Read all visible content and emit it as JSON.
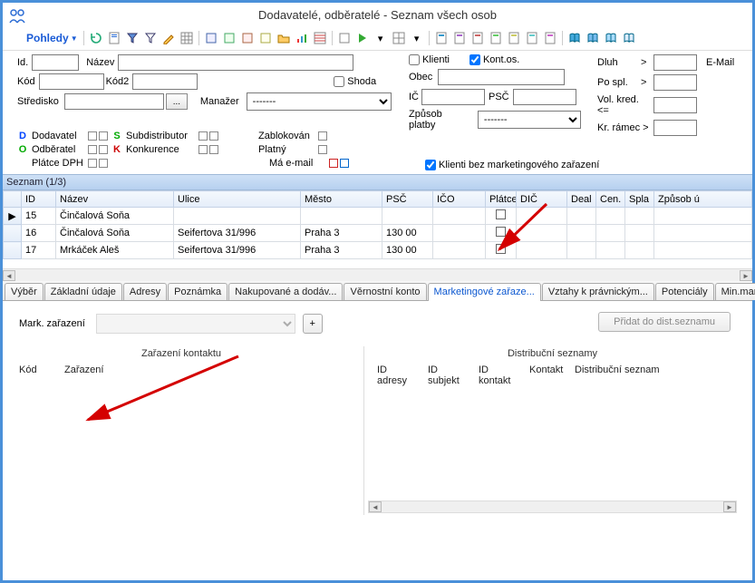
{
  "window": {
    "title": "Dodavatelé, odběratelé - Seznam všech osob"
  },
  "toolbar": {
    "views_label": "Pohledy"
  },
  "filters": {
    "id_label": "Id.",
    "name_label": "Název",
    "kod_label": "Kód",
    "kod2_label": "Kód2",
    "shoda_label": "Shoda",
    "stredisko_label": "Středisko",
    "browse_label": "...",
    "manazer_label": "Manažer",
    "manazer_value": "-------",
    "obec_label": "Obec",
    "ic_label": "IČ",
    "psc_label": "PSČ",
    "zpusob_label": "Způsob platby",
    "zpusob_value": "-------",
    "klienti_label": "Klienti",
    "kontos_label": "Kont.os.",
    "dluh_label": "Dluh",
    "gt": ">",
    "pospl_label": "Po spl.",
    "volkred_label": "Vol. kred. <=",
    "krramec_label": "Kr. rámec >",
    "email_label": "E-Mail",
    "zablokovan_label": "Zablokován",
    "platny_label": "Platný",
    "maemail_label": "Má e-mail",
    "klienti_bez_label": "Klienti bez marketingového zařazení"
  },
  "legend": {
    "d_letter": "D",
    "d_label": "Dodavatel",
    "o_letter": "O",
    "o_label": "Odběratel",
    "platce": "Plátce DPH",
    "s_letter": "S",
    "s_label": "Subdistributor",
    "k_letter": "K",
    "k_label": "Konkurence"
  },
  "grid": {
    "caption": "Seznam (1/3)",
    "columns": [
      "ID",
      "Název",
      "Ulice",
      "Město",
      "PSČ",
      "IČO",
      "Plátce",
      "DIČ",
      "Deal",
      "Cen.",
      "Spla",
      "Způsob ú"
    ],
    "rows": [
      {
        "id": "15",
        "nazev": "Činčalová Soňa",
        "ulice": "",
        "mesto": "",
        "psc": "",
        "ico": ""
      },
      {
        "id": "16",
        "nazev": "Činčalová Soňa",
        "ulice": "Seifertova 31/996",
        "mesto": "Praha 3",
        "psc": "130 00",
        "ico": ""
      },
      {
        "id": "17",
        "nazev": "Mrkáček  Aleš",
        "ulice": "Seifertova 31/996",
        "mesto": "Praha 3",
        "psc": "130 00",
        "ico": ""
      }
    ]
  },
  "tabs": {
    "items": [
      {
        "label": "Výběr"
      },
      {
        "label": "Základní údaje"
      },
      {
        "label": "Adresy"
      },
      {
        "label": "Poznámka"
      },
      {
        "label": "Nakupované a dodáv..."
      },
      {
        "label": "Věrnostní konto"
      },
      {
        "label": "Marketingové zařaze..."
      },
      {
        "label": "Vztahy k právnickým..."
      },
      {
        "label": "Potenciály"
      },
      {
        "label": "Min.marže"
      }
    ],
    "active_index": 6
  },
  "mark_panel": {
    "label": "Mark. zařazení",
    "plus": "+",
    "add_btn": "Přidat do dist.seznamu",
    "left_title": "Zařazení kontaktu",
    "left_cols": {
      "kod": "Kód",
      "zarazeni": "Zařazení"
    },
    "right_title": "Distribuční seznamy",
    "right_cols": {
      "idadr": "ID adresy",
      "idsubj": "ID subjekt",
      "idkont": "ID kontakt",
      "kontakt": "Kontakt",
      "dist": "Distribuční seznam"
    }
  },
  "icons": {
    "row_marker": "▶",
    "chevron_left": "◄",
    "chevron_right": "►"
  }
}
